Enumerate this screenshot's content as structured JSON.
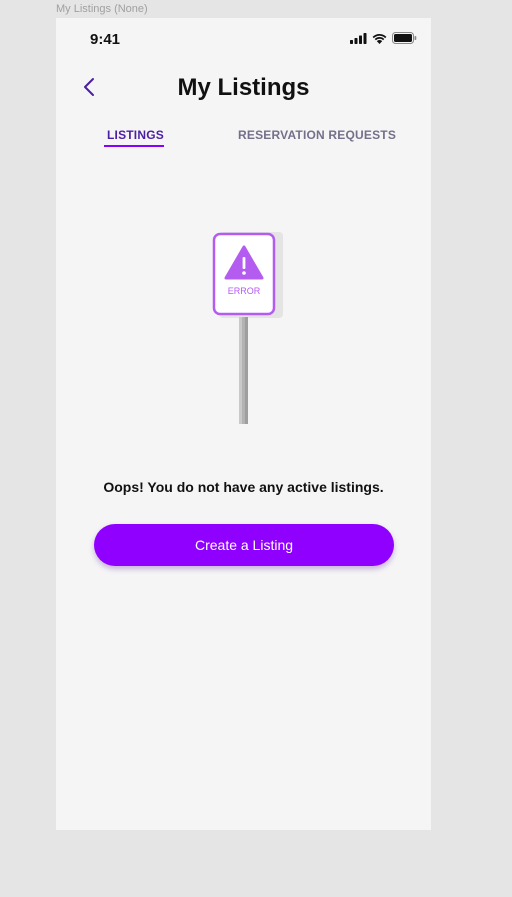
{
  "frame_label": "My Listings (None)",
  "status_bar": {
    "time": "9:41",
    "icons": [
      "signal-icon",
      "wifi-icon",
      "battery-icon"
    ]
  },
  "header": {
    "title": "My Listings",
    "back_icon": "chevron-left-icon"
  },
  "tabs": [
    {
      "label": "LISTINGS",
      "active": true
    },
    {
      "label": "RESERVATION REQUESTS",
      "active": false
    }
  ],
  "illustration": {
    "sign_text": "ERROR",
    "icon": "warning-icon"
  },
  "empty_state": {
    "message": "Oops! You do not have any active listings."
  },
  "cta": {
    "label": "Create a Listing"
  },
  "colors": {
    "accent": "#8f00ff",
    "tab_active": "#4b1fa3",
    "tab_inactive": "#756f8a",
    "sign": "#b45cf0",
    "background": "#f5f5f5"
  }
}
